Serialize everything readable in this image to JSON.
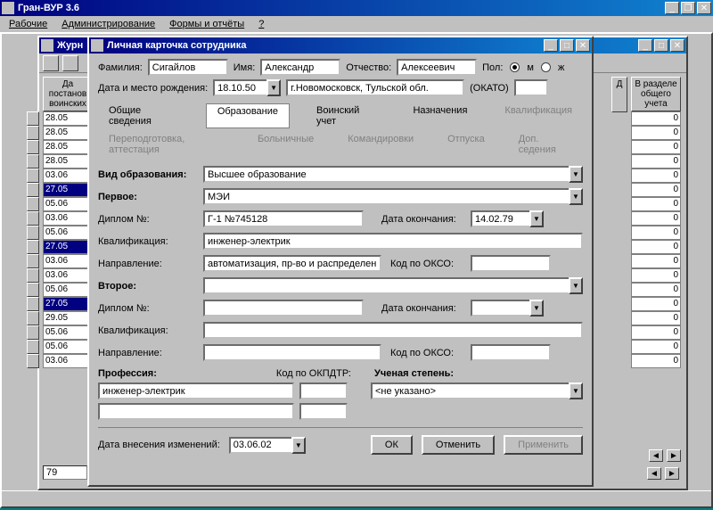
{
  "app": {
    "title": "Гран-ВУР 3.6"
  },
  "menu": {
    "workers": "Рабочие",
    "admin": "Администрирование",
    "forms": "Формы и отчёты",
    "help": "?"
  },
  "jrn": {
    "title": "Журн",
    "leftHeader": "Да\nпостанов\nвоинских",
    "dHeader": "Д",
    "rightHeader": "В разделе\nобщего\nучета",
    "leftDates": [
      "28.05",
      "28.05",
      "28.05",
      "28.05",
      "03.06",
      "27.05",
      "05.06",
      "03.06",
      "05.06",
      "27.05",
      "03.06",
      "03.06",
      "05.06",
      "27.05",
      "29.05",
      "05.06",
      "05.06",
      "03.06"
    ],
    "selectedRows": [
      5,
      9,
      13
    ],
    "rightVals": [
      "0",
      "0",
      "0",
      "0",
      "0",
      "0",
      "0",
      "0",
      "0",
      "0",
      "0",
      "0",
      "0",
      "0",
      "0",
      "0",
      "0",
      "0"
    ],
    "page": "79"
  },
  "modal": {
    "title": "Личная карточка сотрудника",
    "surname_l": "Фамилия:",
    "surname": "Сигайлов",
    "name_l": "Имя:",
    "name": "Александр",
    "patr_l": "Отчество:",
    "patr": "Алексеевич",
    "sex_l": "Пол:",
    "sex_m": "м",
    "sex_f": "ж",
    "sex_val": "м",
    "birth_l": "Дата и место рождения:",
    "birth_date": "18.10.50",
    "birth_place": "г.Новомосковск, Тульской обл.",
    "okato_l": "(ОКАТО)",
    "tabs1": {
      "general": "Общие сведения",
      "education": "Образование",
      "military": "Воинский учет",
      "assign": "Назначения",
      "qual": "Квалификация"
    },
    "tabs1_active": "education",
    "tabs2": {
      "retrain": "Переподготовка, аттестация",
      "sick": "Больничные",
      "trips": "Командировки",
      "vacation": "Отпуска",
      "extra": "Доп. седения"
    },
    "edu_kind_l": "Вид образования:",
    "edu_kind": "Высшее образование",
    "first_l": "Первое:",
    "first": "МЭИ",
    "dip_l": "Диплом №:",
    "dip1": "Г-1 №745128",
    "end_l": "Дата окончания:",
    "end1": "14.02.79",
    "qual_l": "Квалификация:",
    "qual1": "инженер-электрик",
    "dir_l": "Направление:",
    "dir1": "автоматизация, пр-во и распределени",
    "okso_l": "Код по ОКСО:",
    "second_l": "Второе:",
    "second": "",
    "dip2": "",
    "end2": "",
    "qual2": "",
    "dir2": "",
    "prof_l": "Профессия:",
    "okpdtr_l": "Код по ОКПДТР:",
    "degree_l": "Ученая степень:",
    "prof1": "инженер-электрик",
    "prof2": "",
    "okpdtr1": "",
    "okpdtr2": "",
    "degree": "<не указано>",
    "chdate_l": "Дата внесения изменений:",
    "chdate": "03.06.02",
    "ok": "ОК",
    "cancel": "Отменить",
    "apply": "Применить"
  }
}
